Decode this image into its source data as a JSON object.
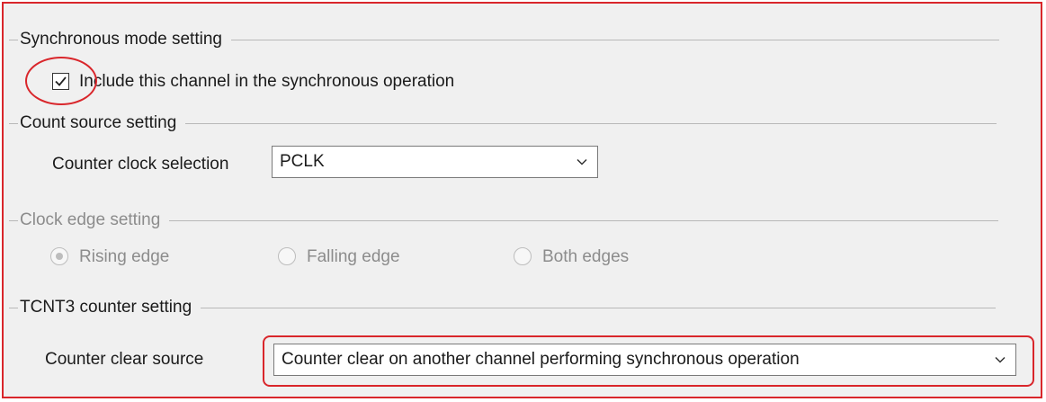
{
  "accent_red": "#d9262b",
  "sync_group": {
    "title": "Synchronous mode setting",
    "checkbox_label": "Include this channel in the synchronous operation",
    "checked": true
  },
  "count_source_group": {
    "title": "Count source setting",
    "clock_label": "Counter clock selection",
    "clock_value": "PCLK"
  },
  "clock_edge_group": {
    "title": "Clock edge setting",
    "enabled": false,
    "options": [
      "Rising edge",
      "Falling edge",
      "Both edges"
    ],
    "selected": "Rising edge"
  },
  "tcnt3_group": {
    "title": "TCNT3 counter setting",
    "clear_label": "Counter clear source",
    "clear_value": "Counter clear on another channel performing synchronous operation"
  }
}
